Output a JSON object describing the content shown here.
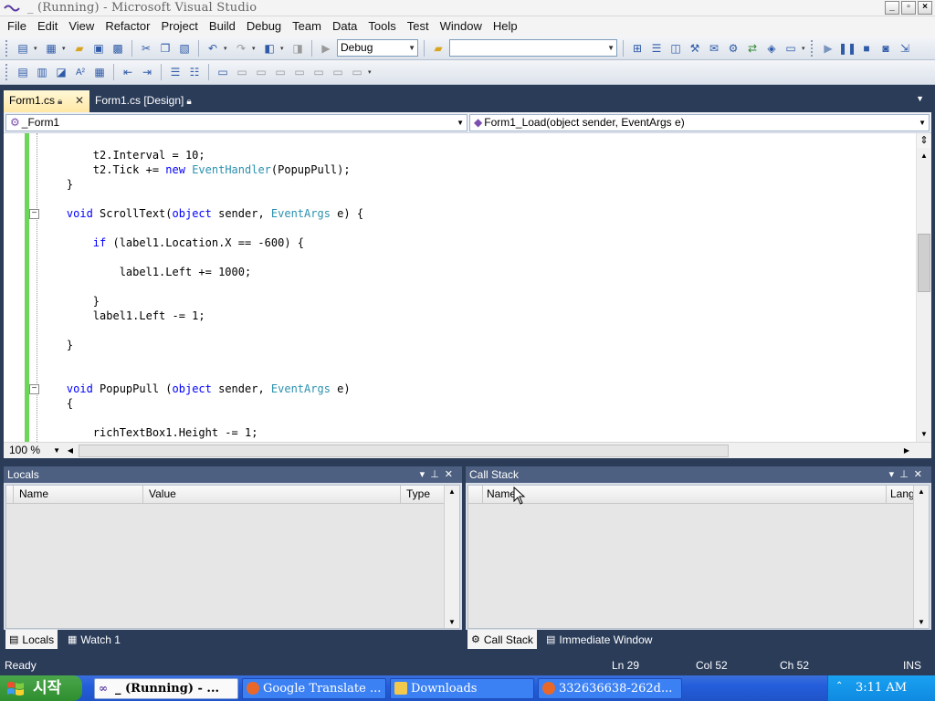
{
  "window": {
    "title": "_ (Running) - Microsoft Visual Studio",
    "controls": [
      "_",
      "▫",
      "×"
    ]
  },
  "menu": [
    "File",
    "Edit",
    "View",
    "Refactor",
    "Project",
    "Build",
    "Debug",
    "Team",
    "Data",
    "Tools",
    "Test",
    "Window",
    "Help"
  ],
  "toolbar": {
    "config": "Debug",
    "platform": ""
  },
  "doc_tabs": [
    {
      "label": "Form1.cs",
      "active": true
    },
    {
      "label": "Form1.cs [Design]",
      "active": false
    }
  ],
  "nav": {
    "class": "_Form1",
    "member": "Form1_Load(object sender, EventArgs e)"
  },
  "code": [
    [
      {
        "t": "        t2.Interval = 10;"
      }
    ],
    [
      {
        "t": "        t2.Tick += "
      },
      {
        "t": "new",
        "c": "kw"
      },
      {
        "t": " "
      },
      {
        "t": "EventHandler",
        "c": "ty"
      },
      {
        "t": "(PopupPull);"
      }
    ],
    [
      {
        "t": "    }"
      }
    ],
    [
      {
        "t": ""
      }
    ],
    [
      {
        "t": "    "
      },
      {
        "t": "void",
        "c": "kw"
      },
      {
        "t": " ScrollText("
      },
      {
        "t": "object",
        "c": "kw"
      },
      {
        "t": " sender, "
      },
      {
        "t": "EventArgs",
        "c": "ty"
      },
      {
        "t": " e) {"
      }
    ],
    [
      {
        "t": ""
      }
    ],
    [
      {
        "t": "        "
      },
      {
        "t": "if",
        "c": "kw"
      },
      {
        "t": " (label1.Location.X == -600) {"
      }
    ],
    [
      {
        "t": ""
      }
    ],
    [
      {
        "t": "            label1.Left += 1000;"
      }
    ],
    [
      {
        "t": ""
      }
    ],
    [
      {
        "t": "        }"
      }
    ],
    [
      {
        "t": "        label1.Left -= 1;"
      }
    ],
    [
      {
        "t": ""
      }
    ],
    [
      {
        "t": "    }"
      }
    ],
    [
      {
        "t": ""
      }
    ],
    [
      {
        "t": ""
      }
    ],
    [
      {
        "t": "    "
      },
      {
        "t": "void",
        "c": "kw"
      },
      {
        "t": " PopupPull ("
      },
      {
        "t": "object",
        "c": "kw"
      },
      {
        "t": " sender, "
      },
      {
        "t": "EventArgs",
        "c": "ty"
      },
      {
        "t": " e)"
      }
    ],
    [
      {
        "t": "    {"
      }
    ],
    [
      {
        "t": ""
      }
    ],
    [
      {
        "t": "        richTextBox1.Height -= 1;"
      }
    ]
  ],
  "zoom": "100 %",
  "locals": {
    "title": "Locals",
    "columns": [
      "Name",
      "Value",
      "Type"
    ],
    "tabs": [
      "Locals",
      "Watch 1"
    ]
  },
  "callstack": {
    "title": "Call Stack",
    "columns": [
      "Name",
      "Lang"
    ],
    "tabs": [
      "Call Stack",
      "Immediate Window"
    ]
  },
  "status": {
    "state": "Ready",
    "ln": "Ln 29",
    "col": "Col 52",
    "ch": "Ch 52",
    "mode": "INS"
  },
  "taskbar": {
    "start": "시작",
    "tasks": [
      "_ (Running) - ...",
      "Google Translate ...",
      "Downloads",
      "332636638-262d..."
    ],
    "clock": "3:11 AM"
  },
  "colors": {
    "chrome": "#2b3c59",
    "keyword": "#0000ff",
    "type": "#2b91af",
    "active_tab": "#ffe8a6",
    "change_bar": "#6bd65a"
  }
}
